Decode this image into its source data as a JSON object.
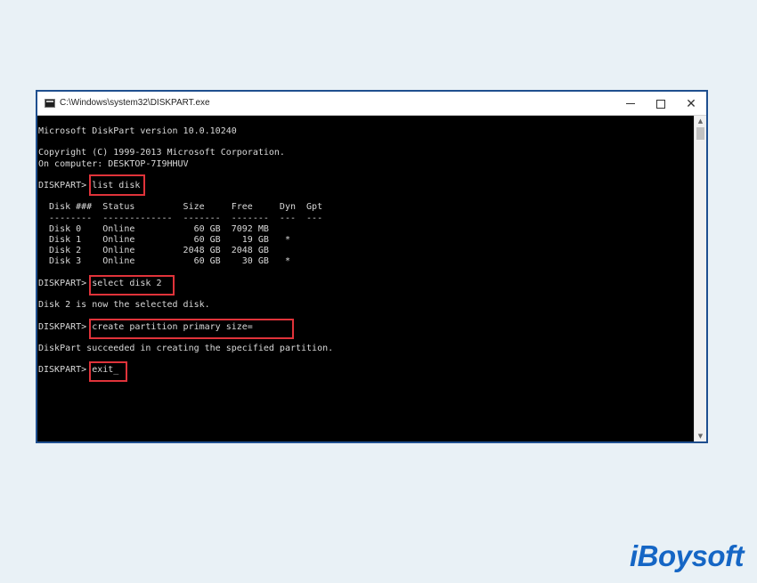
{
  "window": {
    "title": "C:\\Windows\\system32\\DISKPART.exe",
    "border_color": "#1f4f8f",
    "highlight_color": "#e0333a"
  },
  "console": {
    "text": "Microsoft DiskPart version 10.0.10240\n\nCopyright (C) 1999-2013 Microsoft Corporation.\nOn computer: DESKTOP-7I9HHUV\n\nDISKPART> list disk\n\n  Disk ###  Status         Size     Free     Dyn  Gpt\n  --------  -------------  -------  -------  ---  ---\n  Disk 0    Online           60 GB  7092 MB\n  Disk 1    Online           60 GB    19 GB   *\n  Disk 2    Online         2048 GB  2048 GB\n  Disk 3    Online           60 GB    30 GB   *\n\nDISKPART> select disk 2\n\nDisk 2 is now the selected disk.\n\nDISKPART> create partition primary size=\n\nDiskPart succeeded in creating the specified partition.\n\nDISKPART> exit_"
  },
  "brand": {
    "logo_text": "iBoysoft",
    "color": "#1566c5"
  },
  "icons": {
    "minimize": "minimize-icon",
    "maximize": "maximize-icon",
    "close": "close-icon",
    "scroll_up": "chevron-up-icon",
    "scroll_down": "chevron-down-icon"
  }
}
